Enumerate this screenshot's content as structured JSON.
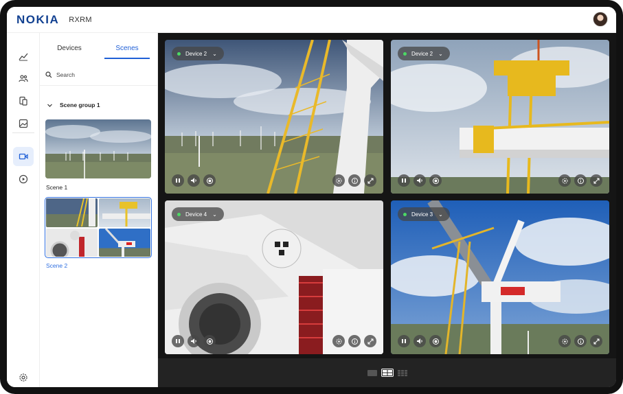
{
  "header": {
    "logo": "NOKIA",
    "app_name": "RXRM"
  },
  "rail": {
    "items": [
      {
        "name": "analytics-icon",
        "active": false
      },
      {
        "name": "users-icon",
        "active": false
      },
      {
        "name": "devices-icon",
        "active": false
      },
      {
        "name": "image-icon",
        "active": false
      },
      {
        "name": "video-icon",
        "active": true
      },
      {
        "name": "play-icon",
        "active": false
      },
      {
        "name": "gear-icon",
        "active": false
      }
    ]
  },
  "panel": {
    "tabs": [
      {
        "label": "Devices",
        "active": false
      },
      {
        "label": "Scenes",
        "active": true
      }
    ],
    "search_label": "Search",
    "group_label": "Scene group 1",
    "scenes": [
      {
        "label": "Scene 1"
      },
      {
        "label": "Scene 2",
        "selected": true
      }
    ]
  },
  "tiles": [
    {
      "device": "Device 2"
    },
    {
      "device": "Device 2"
    },
    {
      "device": "Device 4"
    },
    {
      "device": "Device 3"
    }
  ],
  "layout_options": [
    {
      "name": "single-layout-icon",
      "active": false
    },
    {
      "name": "grid-2x2-layout-icon",
      "active": true
    },
    {
      "name": "grid-3x3-layout-icon",
      "active": false
    }
  ],
  "colors": {
    "brand": "#124191",
    "accent": "#1f5fd6",
    "live": "#4cd964"
  }
}
